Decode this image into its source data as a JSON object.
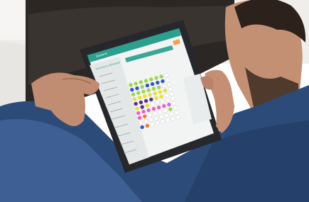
{
  "tablet": {
    "app_name": "Biobank",
    "page_title": "Inventory Browser"
  },
  "colors": {
    "background_top": "#f4f3f1",
    "sofa": "#2a2623",
    "shirt": "#2e4c7a",
    "skin": "#c48e73",
    "tablet_frame": "#2a2c2f",
    "ui_header": "#2c9f8e",
    "well_green": "#9ed84c",
    "well_blue": "#3556c9",
    "well_yellow": "#e4e23a",
    "well_purple": "#5b2e8c",
    "well_pink": "#e865c3",
    "well_orange": "#f07a2a"
  }
}
